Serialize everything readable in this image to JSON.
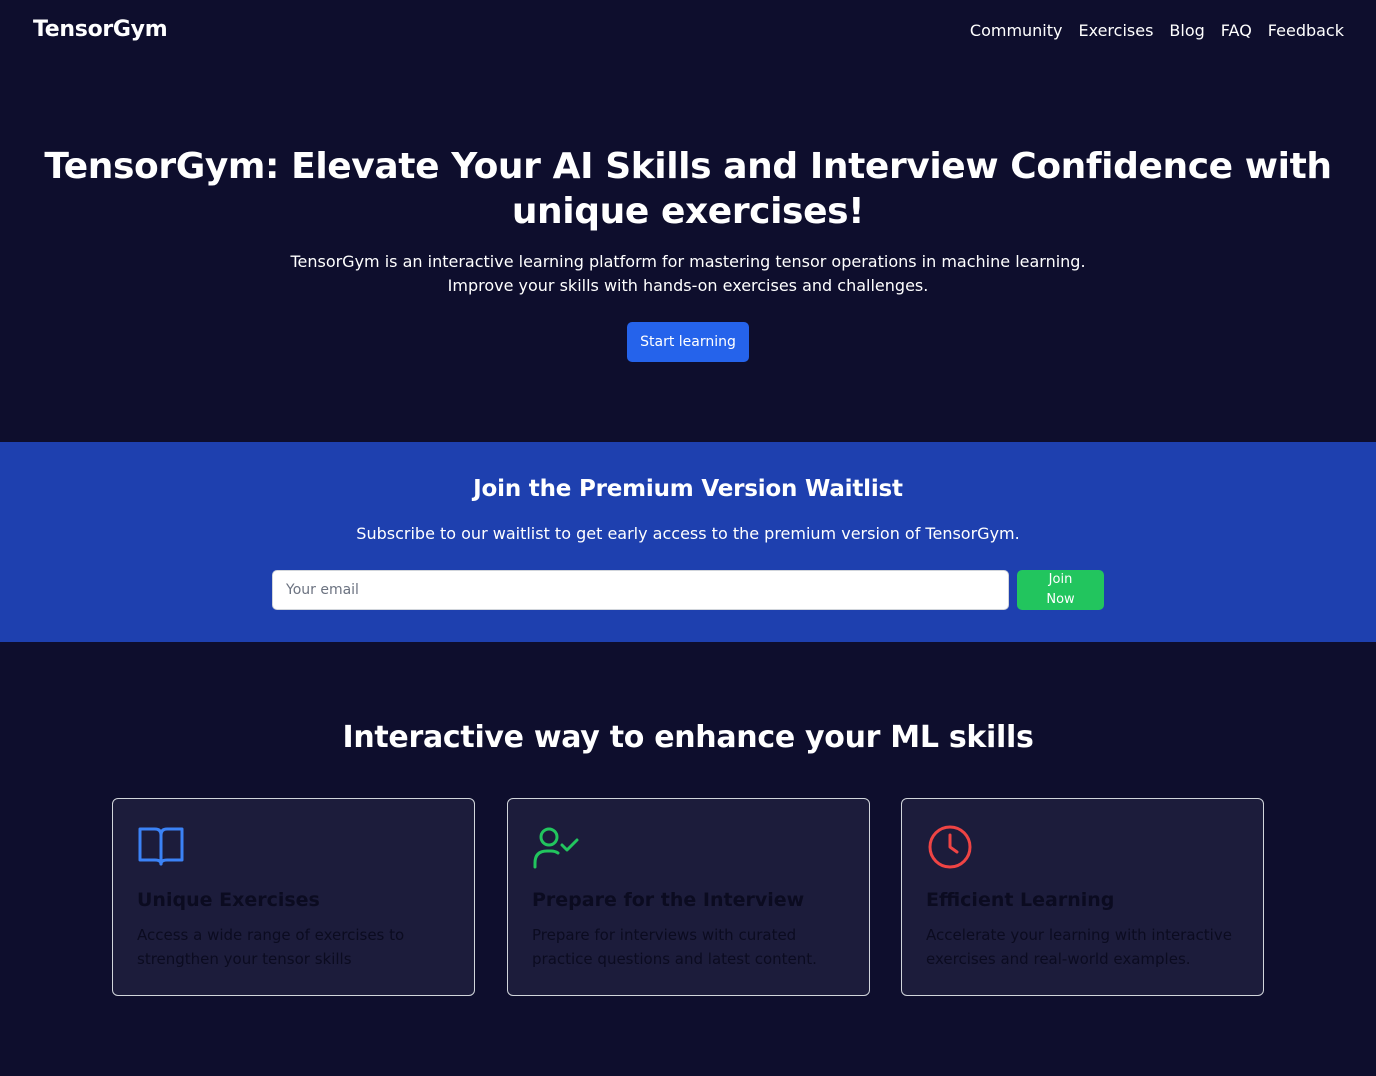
{
  "header": {
    "brand": "TensorGym",
    "nav": [
      "Community",
      "Exercises",
      "Blog",
      "FAQ",
      "Feedback"
    ]
  },
  "hero": {
    "title": "TensorGym: Elevate Your AI Skills and Interview Confidence with unique exercises!",
    "subtitle_line1": "TensorGym is an interactive learning platform for mastering tensor operations in machine learning.",
    "subtitle_line2": "Improve your skills with hands-on exercises and challenges.",
    "cta_label": "Start learning"
  },
  "waitlist": {
    "title": "Join the Premium Version Waitlist",
    "subtitle": "Subscribe to our waitlist to get early access to the premium version of TensorGym.",
    "email_placeholder": "Your email",
    "email_value": "",
    "join_label": "Join Now"
  },
  "features": {
    "title": "Interactive way to enhance your ML skills",
    "cards": [
      {
        "icon": "book-open-icon",
        "icon_color": "#3b82f6",
        "title": "Unique Exercises",
        "description": "Access a wide range of exercises to strengthen your tensor skills"
      },
      {
        "icon": "user-check-icon",
        "icon_color": "#22c55e",
        "title": "Prepare for the Interview",
        "description": "Prepare for interviews with curated practice questions and latest content."
      },
      {
        "icon": "clock-icon",
        "icon_color": "#ef4444",
        "title": "Efficient Learning",
        "description": "Accelerate your learning with interactive exercises and real-world examples."
      }
    ]
  },
  "colors": {
    "background": "#0e0e2d",
    "primary": "#2563eb",
    "waitlist_band": "#1e40af",
    "success": "#22c55e",
    "card_bg": "#1c1c3b"
  }
}
